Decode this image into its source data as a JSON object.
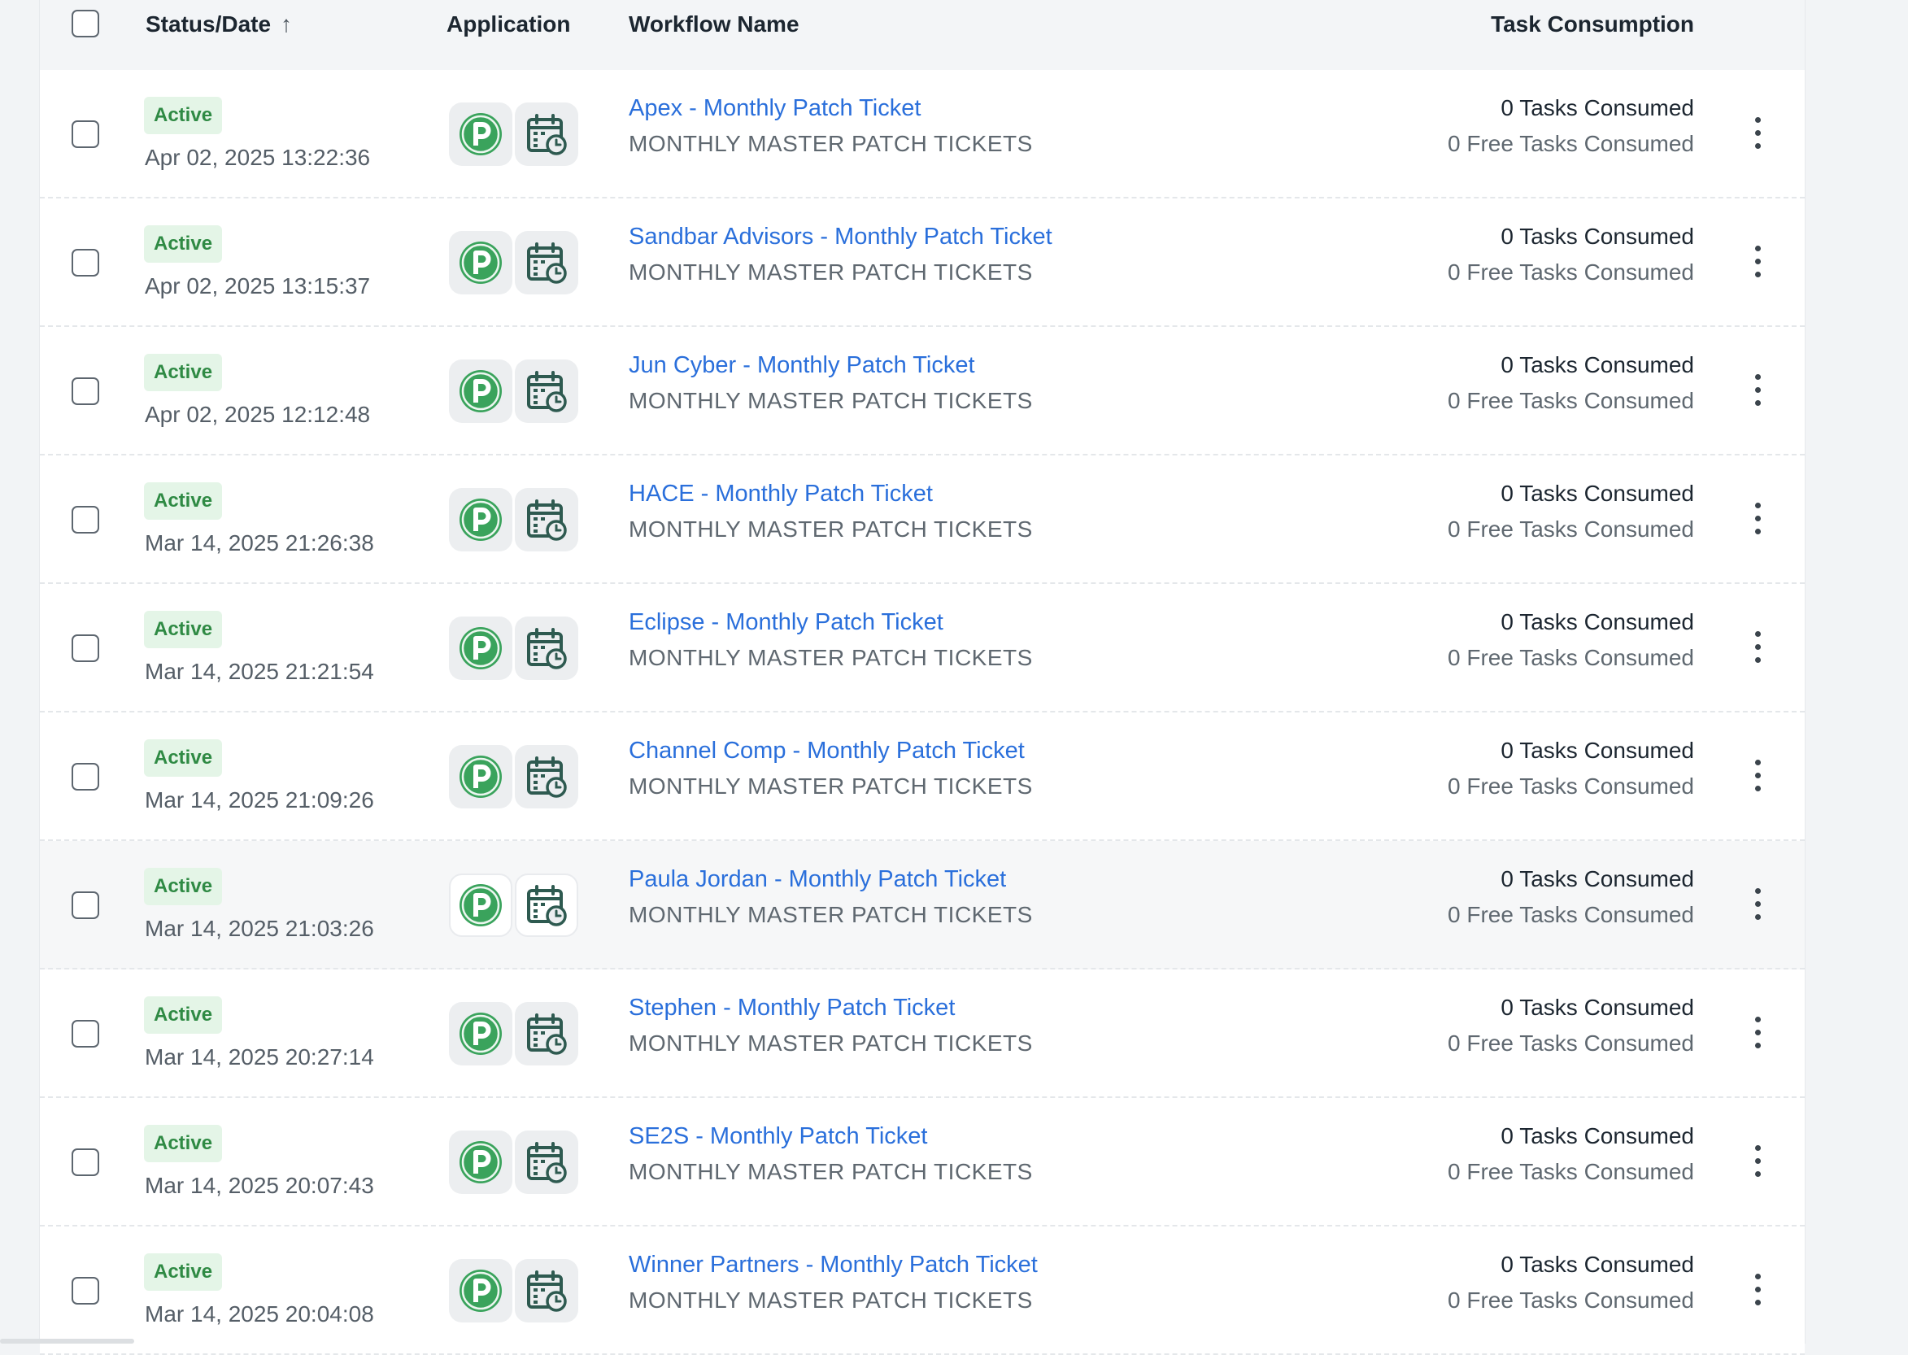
{
  "header": {
    "status_date": "Status/Date",
    "sort_arrow": "↑",
    "application": "Application",
    "workflow_name": "Workflow Name",
    "task_consumption": "Task Consumption"
  },
  "icons": {
    "app1": "pulseway-p-icon",
    "app2": "calendar-clock-icon",
    "menu": "kebab-menu-icon"
  },
  "colors": {
    "active_badge_bg": "#e4f5e7",
    "active_badge_text": "#2f8a44",
    "link": "#2a6fdb",
    "app_green": "#3aa35c",
    "calendar_dark": "#2e5a50"
  },
  "rows": [
    {
      "status": "Active",
      "date": "Apr 02, 2025 13:22:36",
      "name": "Apex - Monthly Patch Ticket",
      "sub": "MONTHLY MASTER PATCH TICKETS",
      "tasks": "0 Tasks Consumed",
      "free": "0 Free Tasks Consumed"
    },
    {
      "status": "Active",
      "date": "Apr 02, 2025 13:15:37",
      "name": "Sandbar Advisors - Monthly Patch Ticket",
      "sub": "MONTHLY MASTER PATCH TICKETS",
      "tasks": "0 Tasks Consumed",
      "free": "0 Free Tasks Consumed"
    },
    {
      "status": "Active",
      "date": "Apr 02, 2025 12:12:48",
      "name": "Jun Cyber - Monthly Patch Ticket",
      "sub": "MONTHLY MASTER PATCH TICKETS",
      "tasks": "0 Tasks Consumed",
      "free": "0 Free Tasks Consumed"
    },
    {
      "status": "Active",
      "date": "Mar 14, 2025 21:26:38",
      "name": "HACE - Monthly Patch Ticket",
      "sub": "MONTHLY MASTER PATCH TICKETS",
      "tasks": "0 Tasks Consumed",
      "free": "0 Free Tasks Consumed"
    },
    {
      "status": "Active",
      "date": "Mar 14, 2025 21:21:54",
      "name": "Eclipse - Monthly Patch Ticket",
      "sub": "MONTHLY MASTER PATCH TICKETS",
      "tasks": "0 Tasks Consumed",
      "free": "0 Free Tasks Consumed"
    },
    {
      "status": "Active",
      "date": "Mar 14, 2025 21:09:26",
      "name": "Channel Comp - Monthly Patch Ticket",
      "sub": "MONTHLY MASTER PATCH TICKETS",
      "tasks": "0 Tasks Consumed",
      "free": "0 Free Tasks Consumed"
    },
    {
      "status": "Active",
      "date": "Mar 14, 2025 21:03:26",
      "name": "Paula Jordan - Monthly Patch Ticket",
      "sub": "MONTHLY MASTER PATCH TICKETS",
      "tasks": "0 Tasks Consumed",
      "free": "0 Free Tasks Consumed"
    },
    {
      "status": "Active",
      "date": "Mar 14, 2025 20:27:14",
      "name": "Stephen - Monthly Patch Ticket",
      "sub": "MONTHLY MASTER PATCH TICKETS",
      "tasks": "0 Tasks Consumed",
      "free": "0 Free Tasks Consumed"
    },
    {
      "status": "Active",
      "date": "Mar 14, 2025 20:07:43",
      "name": "SE2S - Monthly Patch Ticket",
      "sub": "MONTHLY MASTER PATCH TICKETS",
      "tasks": "0 Tasks Consumed",
      "free": "0 Free Tasks Consumed"
    },
    {
      "status": "Active",
      "date": "Mar 14, 2025 20:04:08",
      "name": "Winner Partners - Monthly Patch Ticket",
      "sub": "MONTHLY MASTER PATCH TICKETS",
      "tasks": "0 Tasks Consumed",
      "free": "0 Free Tasks Consumed"
    }
  ]
}
